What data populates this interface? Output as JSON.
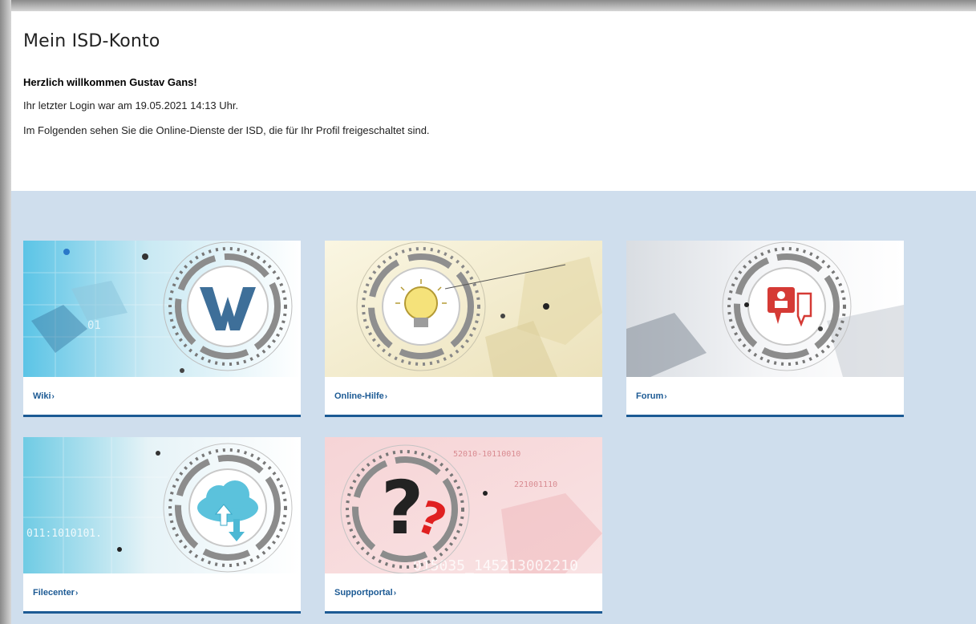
{
  "page": {
    "title": "Mein ISD-Konto",
    "welcome": "Herzlich willkommen Gustav Gans!",
    "last_login": "Ihr letzter Login war am 19.05.2021 14:13 Uhr.",
    "intro": "Im Folgenden sehen Sie die Online-Dienste der ISD, die für Ihr Profil freigeschaltet sind."
  },
  "services": [
    {
      "label": "Wiki",
      "icon": "wiki-w-icon"
    },
    {
      "label": "Online-Hilfe",
      "icon": "lightbulb-icon"
    },
    {
      "label": "Forum",
      "icon": "chat-bubbles-icon"
    },
    {
      "label": "Filecenter",
      "icon": "cloud-upload-download-icon"
    },
    {
      "label": "Supportportal",
      "icon": "question-mark-icon"
    }
  ],
  "colors": {
    "accent": "#1c5a94",
    "services_bg": "#cfdeed"
  },
  "chevron": "›"
}
